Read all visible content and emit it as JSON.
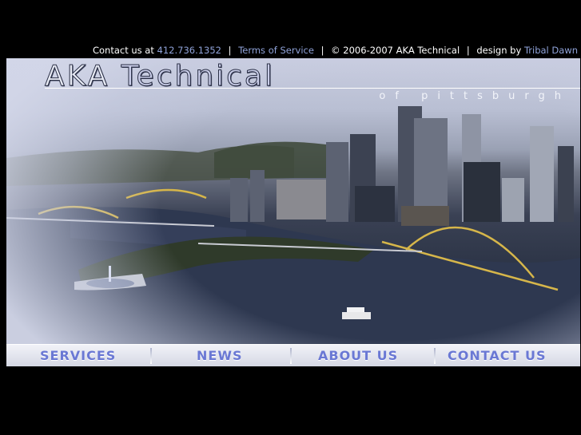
{
  "topbar": {
    "contact_prefix": "Contact us at",
    "phone": "412.736.1352",
    "terms": "Terms of Service",
    "copyright": "© 2006-2007 AKA Technical",
    "design_prefix": "design by",
    "designer": "Tribal Dawn"
  },
  "hero": {
    "brand_first": "AKA",
    "brand_second": "Technical",
    "subtitle": "of pittsburgh"
  },
  "nav": {
    "services": "SERVICES",
    "news": "NEWS",
    "about": "ABOUT US",
    "contact": "CONTACT US"
  },
  "colors": {
    "link": "#8fa2d8",
    "nav_text": "#6a78d4",
    "background": "#000000"
  }
}
